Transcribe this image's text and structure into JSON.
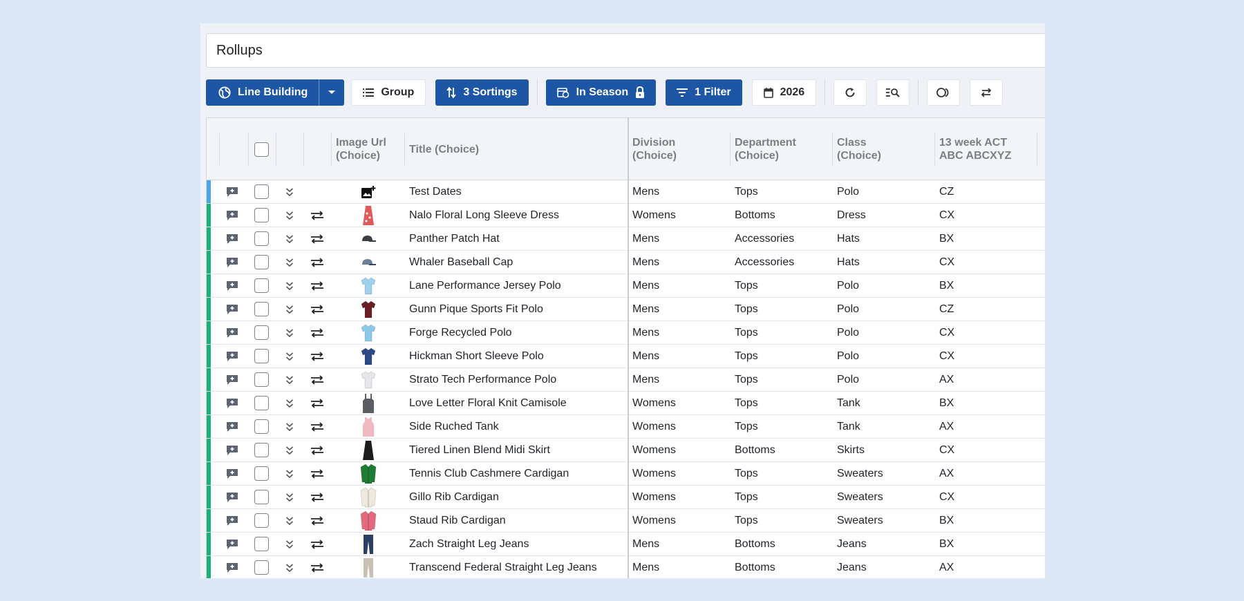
{
  "search": {
    "value": "Rollups"
  },
  "toolbar": {
    "line_building": "Line Building",
    "group": "Group",
    "sortings": "3 Sortings",
    "season": "In Season",
    "filter": "1 Filter",
    "year": "2026"
  },
  "columns": {
    "image": "Image Url (Choice)",
    "title": "Title (Choice)",
    "division": "Division (Choice)",
    "department": "Department (Choice)",
    "class": "Class (Choice)",
    "metric": "13 week ACT ABC ABCXYZ"
  },
  "colors": {
    "accent": "#1c56a5",
    "row_new": "#4aa6e8",
    "row_existing": "#19b07a"
  },
  "rows": [
    {
      "status": "new",
      "thumb": "add-image-icon",
      "title": "Test Dates",
      "division": "Mens",
      "department": "Tops",
      "class": "Polo",
      "abc": "CZ"
    },
    {
      "status": "existing",
      "thumb": "dress-icon",
      "thumbColor": "#e05a5a",
      "title": "Nalo Floral Long Sleeve Dress",
      "division": "Womens",
      "department": "Bottoms",
      "class": "Dress",
      "abc": "CX"
    },
    {
      "status": "existing",
      "thumb": "hat-icon",
      "thumbColor": "#3a3f47",
      "title": "Panther Patch Hat",
      "division": "Mens",
      "department": "Accessories",
      "class": "Hats",
      "abc": "BX"
    },
    {
      "status": "existing",
      "thumb": "cap-icon",
      "thumbColor": "#6a7f98",
      "title": "Whaler Baseball Cap",
      "division": "Mens",
      "department": "Accessories",
      "class": "Hats",
      "abc": "CX"
    },
    {
      "status": "existing",
      "thumb": "polo-icon",
      "thumbColor": "#9fd0ee",
      "title": "Lane Performance Jersey Polo",
      "division": "Mens",
      "department": "Tops",
      "class": "Polo",
      "abc": "BX"
    },
    {
      "status": "existing",
      "thumb": "polo-icon",
      "thumbColor": "#6b1e24",
      "title": "Gunn Pique Sports Fit Polo",
      "division": "Mens",
      "department": "Tops",
      "class": "Polo",
      "abc": "CZ"
    },
    {
      "status": "existing",
      "thumb": "polo-icon",
      "thumbColor": "#8cc8ea",
      "title": "Forge Recycled Polo",
      "division": "Mens",
      "department": "Tops",
      "class": "Polo",
      "abc": "CX"
    },
    {
      "status": "existing",
      "thumb": "polo-icon",
      "thumbColor": "#2e4a86",
      "title": "Hickman Short Sleeve Polo",
      "division": "Mens",
      "department": "Tops",
      "class": "Polo",
      "abc": "CX"
    },
    {
      "status": "existing",
      "thumb": "polo-icon",
      "thumbColor": "#e6e7ea",
      "title": "Strato Tech Performance Polo",
      "division": "Mens",
      "department": "Tops",
      "class": "Polo",
      "abc": "AX"
    },
    {
      "status": "existing",
      "thumb": "camisole-icon",
      "thumbColor": "#5a5d63",
      "title": "Love Letter Floral Knit Camisole",
      "division": "Womens",
      "department": "Tops",
      "class": "Tank",
      "abc": "BX"
    },
    {
      "status": "existing",
      "thumb": "tank-icon",
      "thumbColor": "#f2b9c3",
      "title": "Side Ruched Tank",
      "division": "Womens",
      "department": "Tops",
      "class": "Tank",
      "abc": "AX"
    },
    {
      "status": "existing",
      "thumb": "skirt-icon",
      "thumbColor": "#1b1b1d",
      "title": "Tiered Linen Blend Midi Skirt",
      "division": "Womens",
      "department": "Bottoms",
      "class": "Skirts",
      "abc": "CX"
    },
    {
      "status": "existing",
      "thumb": "cardigan-icon",
      "thumbColor": "#1f7a33",
      "title": "Tennis Club Cashmere Cardigan",
      "division": "Womens",
      "department": "Tops",
      "class": "Sweaters",
      "abc": "AX"
    },
    {
      "status": "existing",
      "thumb": "cardigan-icon",
      "thumbColor": "#efe8dc",
      "title": "Gillo Rib Cardigan",
      "division": "Womens",
      "department": "Tops",
      "class": "Sweaters",
      "abc": "CX"
    },
    {
      "status": "existing",
      "thumb": "cardigan-icon",
      "thumbColor": "#e36a7d",
      "title": "Staud Rib Cardigan",
      "division": "Womens",
      "department": "Tops",
      "class": "Sweaters",
      "abc": "BX"
    },
    {
      "status": "existing",
      "thumb": "jeans-icon",
      "thumbColor": "#2b3e63",
      "title": "Zach Straight Leg Jeans",
      "division": "Mens",
      "department": "Bottoms",
      "class": "Jeans",
      "abc": "BX"
    },
    {
      "status": "existing",
      "thumb": "jeans-icon",
      "thumbColor": "#c9bfb2",
      "title": "Transcend Federal Straight Leg Jeans",
      "division": "Mens",
      "department": "Bottoms",
      "class": "Jeans",
      "abc": "AX"
    }
  ]
}
